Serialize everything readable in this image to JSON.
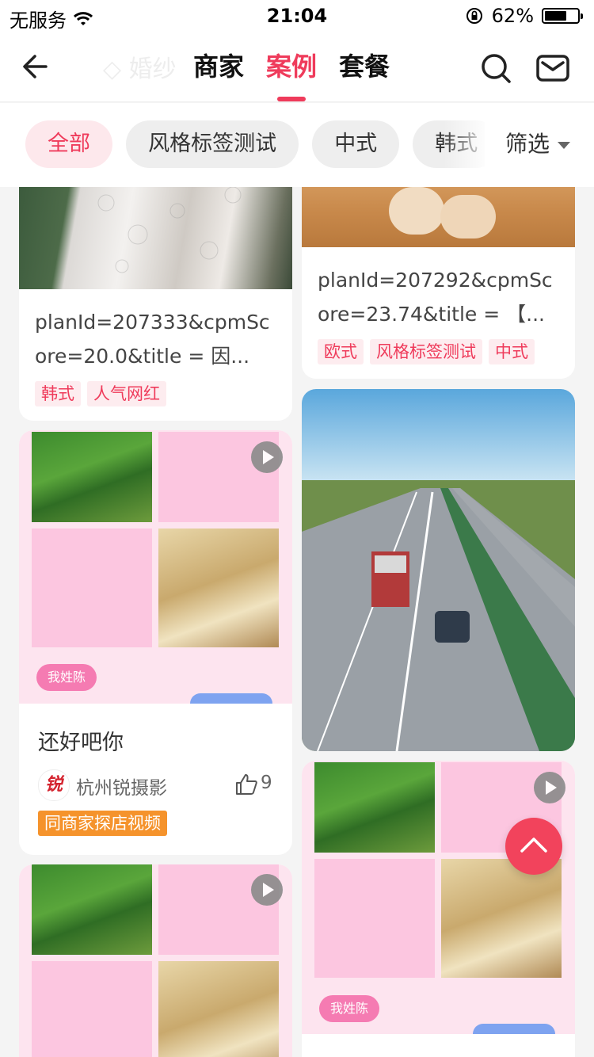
{
  "status_bar": {
    "carrier": "无服务",
    "time": "21:04",
    "battery": "62%",
    "battery_level": 0.62
  },
  "nav": {
    "ghost_text": "◇ 婚纱",
    "tabs": [
      {
        "label": "商家",
        "active": false
      },
      {
        "label": "案例",
        "active": true
      },
      {
        "label": "套餐",
        "active": false
      }
    ]
  },
  "filters": {
    "chips": [
      {
        "label": "全部",
        "active": true
      },
      {
        "label": "风格标签测试",
        "active": false
      },
      {
        "label": "中式",
        "active": false
      },
      {
        "label": "韩式",
        "active": false
      }
    ],
    "filter_label": "筛选"
  },
  "cards": {
    "left1": {
      "title": "planId=207333&cpmScore=20.0&title = 因...",
      "tags": [
        "韩式",
        "人气网红"
      ]
    },
    "right1": {
      "title": "planId=207292&cpmScore=23.74&title = 【...",
      "tags": [
        "欧式",
        "风格标签测试",
        "中式"
      ]
    },
    "left2": {
      "bubble": "我姓陈",
      "title": "还好吧你",
      "shop": "杭州锐摄影",
      "shop_logo": "锐",
      "likes": "9",
      "badge": "同商家探店视频"
    },
    "left3": {
      "bubble": ""
    },
    "right3": {
      "bubble": "我姓陈"
    }
  },
  "icons": [
    "back-arrow-icon",
    "search-icon",
    "mail-icon",
    "play-icon",
    "thumbs-up-icon",
    "chevron-up-icon",
    "wifi-icon",
    "rotation-lock-icon",
    "battery-icon"
  ],
  "colors": {
    "accent": "#ef3b5b",
    "badge_orange": "#f5932c",
    "fab": "#f2435c"
  }
}
